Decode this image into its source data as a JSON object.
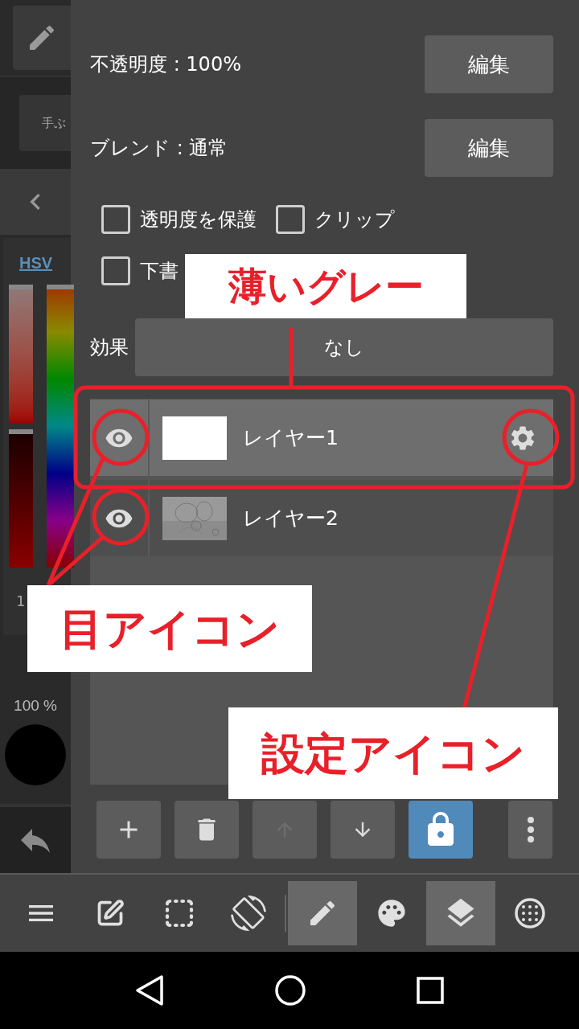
{
  "sidebar": {
    "brush_label": "手ぶ",
    "color_mode": "HSV",
    "saturation": {
      "level": 1
    },
    "brightness": {
      "level": 1
    },
    "hue": {
      "level": 1
    },
    "value_reading": "1",
    "opacity_reading": "100 %"
  },
  "properties": {
    "opacity_label": "不透明度 : 100%",
    "opacity_button": "編集",
    "blend_label": "ブレンド : 通常",
    "blend_button": "編集",
    "effect_label": "効果",
    "effect_value": "なし",
    "checkboxes": [
      {
        "label": "透明度を保護",
        "checked": false
      },
      {
        "label": "クリップ",
        "checked": false
      },
      {
        "label": "下書",
        "checked": false
      }
    ]
  },
  "layers": [
    {
      "name": "レイヤー1",
      "visible": true,
      "selected": true,
      "thumbnail": {
        "kind": "blank"
      }
    },
    {
      "name": "レイヤー2",
      "visible": true,
      "selected": false
    }
  ],
  "layer_actions": [
    {
      "kind": "add",
      "disabled": false,
      "on": false
    },
    {
      "kind": "delete",
      "disabled": false,
      "on": false
    },
    {
      "kind": "up",
      "disabled": true,
      "on": false
    },
    {
      "kind": "down",
      "disabled": false,
      "on": false
    },
    {
      "kind": "lock",
      "disabled": false,
      "on": true
    },
    {
      "kind": "more",
      "disabled": false,
      "on": false
    }
  ],
  "toolbar": [
    {
      "kind": "menu",
      "selected": false
    },
    {
      "kind": "edit",
      "selected": false
    },
    {
      "kind": "select",
      "selected": false
    },
    {
      "kind": "rotate",
      "selected": false
    },
    {
      "kind": "pen",
      "selected": true
    },
    {
      "kind": "palette",
      "selected": false
    },
    {
      "kind": "layers",
      "selected": true
    },
    {
      "kind": "grid",
      "selected": false
    }
  ],
  "annotations": [
    {
      "text": "薄いグレー"
    },
    {
      "text": "目アイコン"
    },
    {
      "text": "設定アイコン"
    }
  ]
}
